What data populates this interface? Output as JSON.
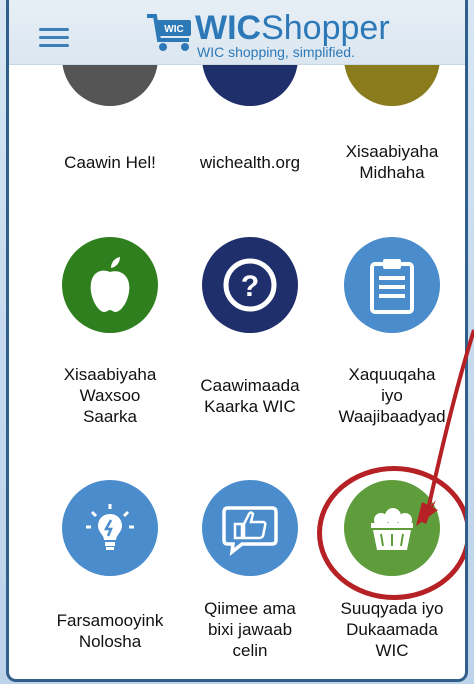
{
  "app": {
    "brand_bold": "WIC",
    "brand_regular": "Shopper",
    "tagline": "WIC shopping, simplified.",
    "cart_badge": "WIC",
    "colors": {
      "accent": "#2d79b8",
      "highlight": "#b52124"
    }
  },
  "tiles": [
    {
      "id": "caawin-hel",
      "label": "Caawin Hel!",
      "icon": "circle-gray-icon"
    },
    {
      "id": "wichealth",
      "label": "wichealth.org",
      "icon": "circle-navy-icon"
    },
    {
      "id": "xisaabiyaha-midhaha",
      "label": "Xisaabiyaha\nMidhaha",
      "icon": "circle-olive-icon"
    },
    {
      "id": "xisaabiyaha-waxsoo",
      "label": "Xisaabiyaha\nWaxsoo\nSaarka",
      "icon": "apple-icon"
    },
    {
      "id": "caawimaada-kaarka",
      "label": "Caawimaada\nKaarka WIC",
      "icon": "question-icon"
    },
    {
      "id": "xaquuqaha",
      "label": "Xaquuqaha\niyo\nWaajibaadyad",
      "icon": "clipboard-icon"
    },
    {
      "id": "farsamooyink",
      "label": "Farsamooyink\nNolosha",
      "icon": "lightbulb-icon"
    },
    {
      "id": "qiimee",
      "label": "Qiimee ama\nbixi jawaab\ncelin",
      "icon": "thumbs-up-icon"
    },
    {
      "id": "suuqyada",
      "label": "Suuqyada iyo\nDukaamada\nWIC",
      "icon": "basket-icon"
    }
  ]
}
